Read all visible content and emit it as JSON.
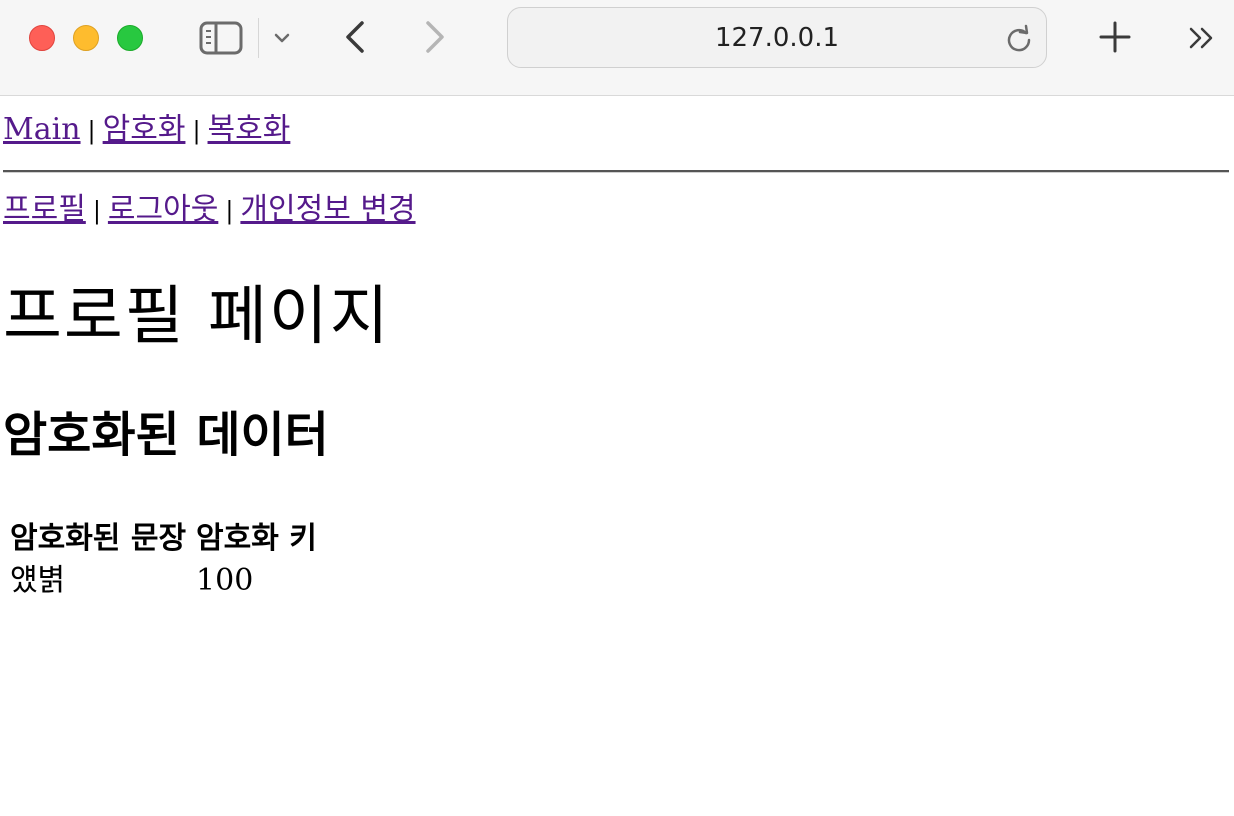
{
  "browser": {
    "url": "127.0.0.1",
    "icons": {
      "sidebar": "sidebar-icon",
      "tab_overview": "chevron-down-icon",
      "back": "chevron-left-icon",
      "forward": "chevron-right-icon",
      "reload": "reload-icon",
      "new_tab": "plus-icon",
      "more": "double-chevron-right-icon"
    },
    "colors": {
      "close": "#fe5f57",
      "minimize": "#febc2e",
      "zoom": "#28c840"
    }
  },
  "nav": {
    "separator": "|",
    "main": {
      "items": [
        "Main",
        "암호화",
        "복호화"
      ]
    },
    "user": {
      "items": [
        "프로필",
        "로그아웃",
        "개인정보 변경"
      ]
    },
    "link_color": "#551a8b"
  },
  "page": {
    "title": "프로필 페이지",
    "subtitle": "암호화된 데이터"
  },
  "table": {
    "headers": [
      "암호화된 문장",
      "암호화 키"
    ],
    "rows": [
      [
        "얬볅",
        "100"
      ]
    ]
  }
}
